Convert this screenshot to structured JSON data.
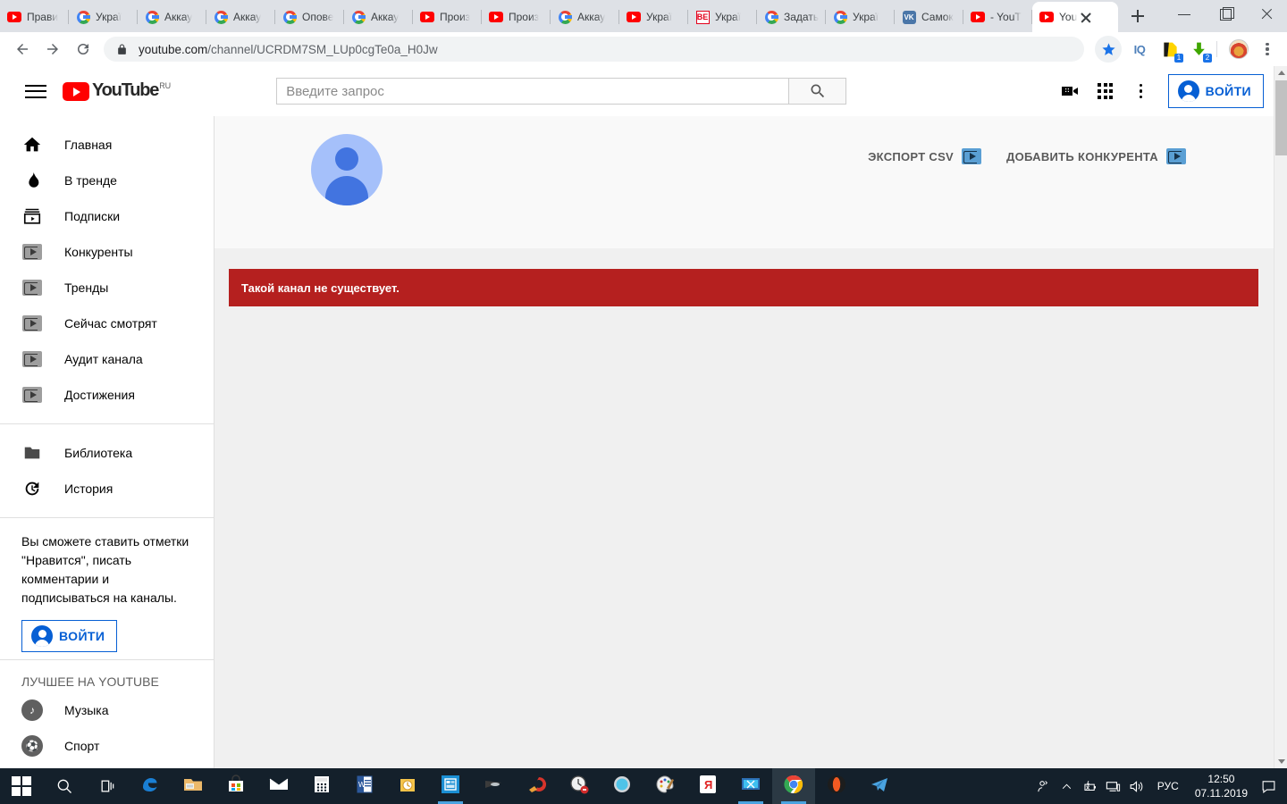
{
  "browser": {
    "tabs": [
      {
        "title": "Прави",
        "favicon": "youtube-icon"
      },
      {
        "title": "Украї",
        "favicon": "google-icon"
      },
      {
        "title": "Аккау",
        "favicon": "google-icon"
      },
      {
        "title": "Аккау",
        "favicon": "google-icon"
      },
      {
        "title": "Опове",
        "favicon": "google-icon"
      },
      {
        "title": "Аккау",
        "favicon": "google-icon"
      },
      {
        "title": "Произ",
        "favicon": "youtube-icon"
      },
      {
        "title": "Произ",
        "favicon": "youtube-icon"
      },
      {
        "title": "Аккау",
        "favicon": "google-icon"
      },
      {
        "title": "Украї",
        "favicon": "youtube-icon"
      },
      {
        "title": "Украї",
        "favicon": "be-icon"
      },
      {
        "title": "Задать",
        "favicon": "google-icon"
      },
      {
        "title": "Украї",
        "favicon": "google-icon"
      },
      {
        "title": "Самок",
        "favicon": "vk-icon"
      },
      {
        "title": "- YouT",
        "favicon": "youtube-icon"
      },
      {
        "title": "You",
        "favicon": "youtube-icon",
        "active": true
      }
    ],
    "new_tab_label": "+",
    "window_controls": {
      "minimize": "—",
      "maximize": "❐",
      "close": "✕"
    },
    "omnibox": {
      "domain": "youtube.com",
      "path": "/channel/UCRDM7SM_LUp0cgTe0a_H0Jw",
      "secure": true
    },
    "toolbar_extensions": [
      {
        "name": "iq-extension",
        "label": "IQ"
      },
      {
        "name": "notes-extension",
        "badge": "1"
      },
      {
        "name": "downloader-extension",
        "badge": "2"
      }
    ]
  },
  "youtube": {
    "logo_word": "YouTube",
    "logo_country": "RU",
    "search": {
      "placeholder": "Введите запрос",
      "value": ""
    },
    "signin_label": "ВОЙТИ",
    "sidebar": {
      "primary": [
        {
          "label": "Главная",
          "icon": "home-icon"
        },
        {
          "label": "В тренде",
          "icon": "trending-flame-icon"
        },
        {
          "label": "Подписки",
          "icon": "subscriptions-icon"
        },
        {
          "label": "Конкуренты",
          "icon": "extension-flag-icon"
        },
        {
          "label": "Тренды",
          "icon": "extension-flag-icon"
        },
        {
          "label": "Сейчас смотрят",
          "icon": "extension-flag-icon"
        },
        {
          "label": "Аудит канала",
          "icon": "extension-flag-icon"
        },
        {
          "label": "Достижения",
          "icon": "extension-flag-icon"
        }
      ],
      "secondary": [
        {
          "label": "Библиотека",
          "icon": "folder-icon"
        },
        {
          "label": "История",
          "icon": "history-clock-icon"
        }
      ],
      "promo_text": "Вы сможете ставить отметки \"Нравится\", писать комментарии и подписываться на каналы.",
      "promo_signin_label": "ВОЙТИ",
      "best_heading": "ЛУЧШЕЕ НА YOUTUBE",
      "best_items": [
        {
          "label": "Музыка",
          "icon": "music-note-icon"
        },
        {
          "label": "Спорт",
          "icon": "sports-icon"
        }
      ]
    },
    "channel": {
      "avatar": "default-user-avatar",
      "actions": [
        {
          "label": "ЭКСПОРТ CSV",
          "icon": "blue-flag-icon"
        },
        {
          "label": "ДОБАВИТЬ КОНКУРЕНТА",
          "icon": "blue-flag-icon"
        }
      ],
      "error_message": "Такой канал не существует."
    }
  },
  "taskbar": {
    "start": "windows-logo-icon",
    "search": "search-icon",
    "taskview": "task-view-icon",
    "apps": [
      {
        "name": "edge-icon"
      },
      {
        "name": "file-explorer-icon"
      },
      {
        "name": "microsoft-store-icon"
      },
      {
        "name": "mail-icon"
      },
      {
        "name": "calculator-icon"
      },
      {
        "name": "word-icon"
      },
      {
        "name": "outlook-icon"
      },
      {
        "name": "excel-blue-icon",
        "running": true
      },
      {
        "name": "scanner-icon"
      },
      {
        "name": "ccleaner-icon"
      },
      {
        "name": "timer-icon"
      },
      {
        "name": "blue-orb-icon"
      },
      {
        "name": "paint-icon"
      },
      {
        "name": "yandex-icon"
      },
      {
        "name": "screenshot-tool-icon",
        "running": true
      },
      {
        "name": "chrome-icon",
        "active": true,
        "running": true
      },
      {
        "name": "opera-icon"
      },
      {
        "name": "telegram-icon"
      }
    ],
    "tray": {
      "people": "people-icon",
      "chevron": "show-hidden-icons-icon",
      "battery": "battery-icon",
      "network": "network-icon",
      "volume": "volume-icon",
      "language": "РУС",
      "time": "12:50",
      "date": "07.11.2019",
      "action_center": "notifications-icon"
    }
  },
  "colors": {
    "youtube_red": "#ff0000",
    "error_red": "#b5201f",
    "link_blue": "#065fd4",
    "taskbar_dark": "#14202b",
    "page_gray": "#f0f0f0"
  }
}
